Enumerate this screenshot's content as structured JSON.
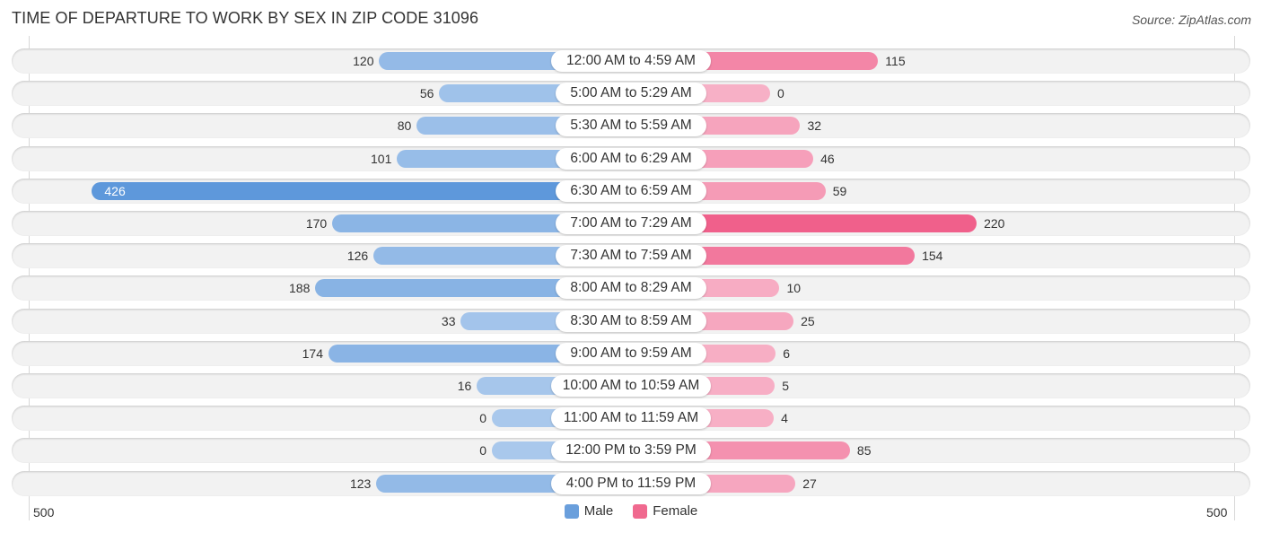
{
  "chart_data": {
    "type": "bar",
    "orientation": "horizontal-diverging",
    "title": "TIME OF DEPARTURE TO WORK BY SEX IN ZIP CODE 31096",
    "source": "Source: ZipAtlas.com",
    "categories": [
      "12:00 AM to 4:59 AM",
      "5:00 AM to 5:29 AM",
      "5:30 AM to 5:59 AM",
      "6:00 AM to 6:29 AM",
      "6:30 AM to 6:59 AM",
      "7:00 AM to 7:29 AM",
      "7:30 AM to 7:59 AM",
      "8:00 AM to 8:29 AM",
      "8:30 AM to 8:59 AM",
      "9:00 AM to 9:59 AM",
      "10:00 AM to 10:59 AM",
      "11:00 AM to 11:59 AM",
      "12:00 PM to 3:59 PM",
      "4:00 PM to 11:59 PM"
    ],
    "series": [
      {
        "name": "Male",
        "color": "#6a9fdc",
        "values": [
          120,
          56,
          80,
          101,
          426,
          170,
          126,
          188,
          33,
          174,
          16,
          0,
          0,
          123
        ]
      },
      {
        "name": "Female",
        "color": "#f0698f",
        "values": [
          115,
          0,
          32,
          46,
          59,
          220,
          154,
          10,
          25,
          6,
          5,
          4,
          85,
          27
        ]
      }
    ],
    "axis": {
      "left_label": "500",
      "right_label": "500",
      "range": [
        0,
        500
      ]
    },
    "legend": {
      "position": "bottom-center",
      "items": [
        "Male",
        "Female"
      ]
    }
  }
}
